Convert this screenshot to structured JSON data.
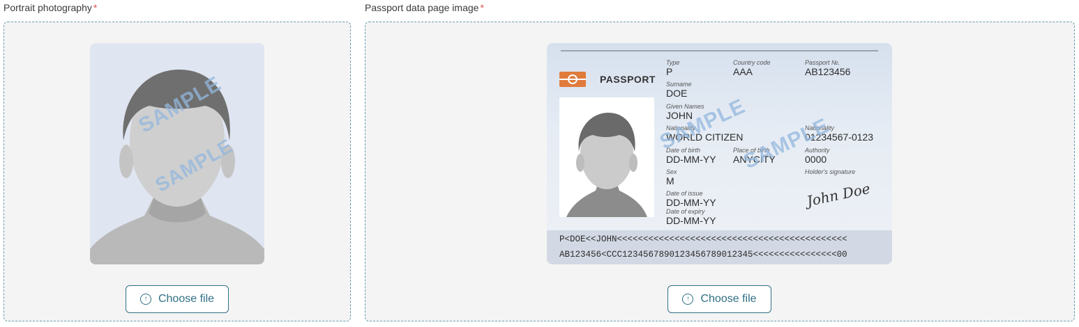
{
  "portrait": {
    "label": "Portrait photography",
    "required_mark": "*",
    "watermark": "SAMPLE",
    "choose_label": "Choose file"
  },
  "passport": {
    "label": "Passport data page image",
    "required_mark": "*",
    "choose_label": "Choose file",
    "card": {
      "title": "PASSPORT",
      "watermark": "SAMPLE",
      "fields": {
        "type": {
          "label": "Type",
          "value": "P"
        },
        "country_code": {
          "label": "Country code",
          "value": "AAA"
        },
        "passport_no": {
          "label": "Passport №.",
          "value": "AB123456"
        },
        "surname": {
          "label": "Surname",
          "value": "DOE"
        },
        "given_names": {
          "label": "Given Names",
          "value": "JOHN"
        },
        "nationality": {
          "label": "Nationality",
          "value": "WORLD CITIZEN"
        },
        "personal_no": {
          "label": "Nationality",
          "value": "01234567-0123"
        },
        "dob": {
          "label": "Date of birth",
          "value": "DD-MM-YY"
        },
        "place_of_birth": {
          "label": "Place of birth",
          "value": "ANYCITY"
        },
        "authority": {
          "label": "Authority",
          "value": "0000"
        },
        "sex": {
          "label": "Sex",
          "value": "M"
        },
        "signature_label": "Holder's signature",
        "signature": "John Doe",
        "date_of_issue": {
          "label": "Date of issue",
          "value": "DD-MM-YY"
        },
        "date_of_expiry": {
          "label": "Date of expiry",
          "value": "DD-MM-YY"
        }
      },
      "mrz_line1": "P<DOE<<JOHN<<<<<<<<<<<<<<<<<<<<<<<<<<<<<<<<<<<<<<<<<<<<",
      "mrz_line2": "AB123456<CCC1234567890123456789012345<<<<<<<<<<<<<<<<00"
    }
  },
  "colors": {
    "accent": "#2f6f85",
    "required": "#d9534f",
    "dropzone_bg": "#f4f4f4"
  }
}
